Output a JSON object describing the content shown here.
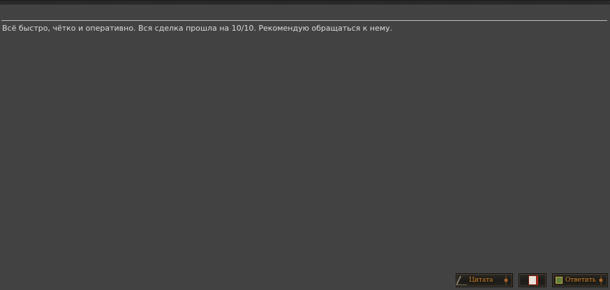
{
  "post": {
    "text": "Всё быстро, чётко и оперативно. Вся сделка прошла на 10/10. Рекомендую обращаться к нему."
  },
  "actions": {
    "quote_label": "Цитата",
    "reply_label": "Ответить"
  },
  "colors": {
    "background": "#424242",
    "text": "#dcdcdc",
    "divider": "#bdbdbd",
    "button_text": "#d88a2a"
  },
  "icons": {
    "report": "report-icon",
    "reply": "home-icon"
  }
}
